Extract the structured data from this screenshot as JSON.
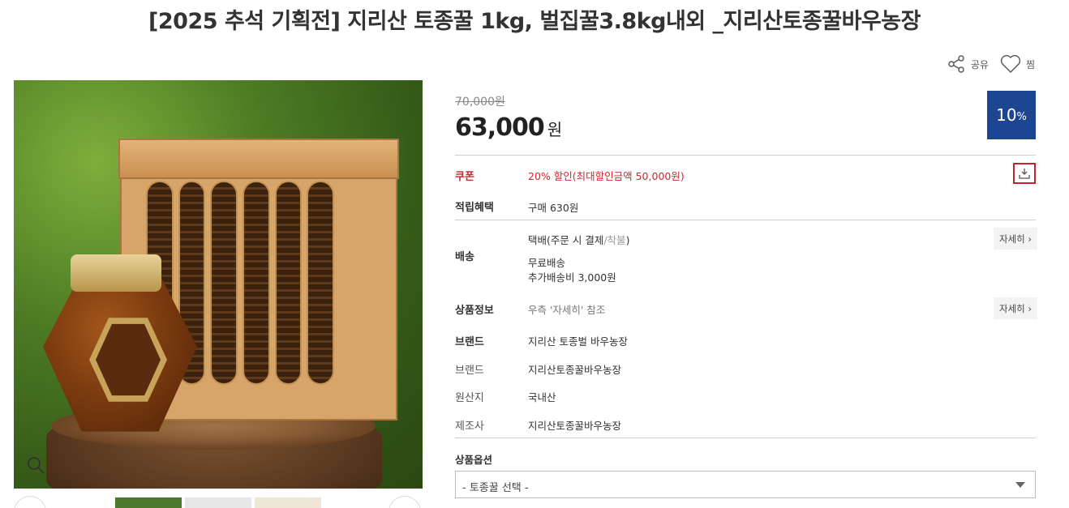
{
  "title": "[2025 추석 기획전] 지리산 토종꿀 1kg, 벌집꿀3.8kg내외 _지리산토종꿀바우농장",
  "actions": {
    "share_label": "공유",
    "wish_label": "찜"
  },
  "price": {
    "original": "70,000",
    "original_unit": "원",
    "sale": "63,000",
    "sale_unit": "원",
    "discount_value": "10",
    "discount_unit": "%"
  },
  "coupon": {
    "label": "쿠폰",
    "value": "20% 할인(최대할인금액 50,000원)"
  },
  "points": {
    "label": "적립혜택",
    "value": "구매 630원"
  },
  "shipping": {
    "label": "배송",
    "method": "택배(주문 시 결제",
    "method_sep": "/",
    "method_extra": "착불",
    "method_close": ")",
    "free": "무료배송",
    "extra_fee": "추가배송비 3,000원",
    "detail_label": "자세히 ›"
  },
  "product_info": {
    "label": "상품정보",
    "value": "우측 '자세히' 참조",
    "detail_label": "자세히 ›"
  },
  "brand_main": {
    "label": "브랜드",
    "value": "지리산 토종벌 바우농장"
  },
  "specs": [
    {
      "label": "브랜드",
      "value": "지리산토종꿀바우농장"
    },
    {
      "label": "원산지",
      "value": "국내산"
    },
    {
      "label": "제조사",
      "value": "지리산토종꿀바우농장"
    }
  ],
  "options": {
    "label": "상품옵션",
    "placeholder": "- 토종꿀 선택 -"
  },
  "colors": {
    "accent_red": "#d0262c",
    "badge_blue": "#1c4592"
  }
}
